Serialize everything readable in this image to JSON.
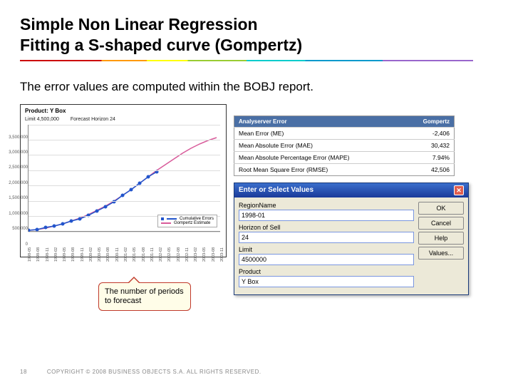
{
  "title": {
    "line1": "Simple Non Linear Regression",
    "line2": "Fitting a S-shaped curve (Gompertz)"
  },
  "body_text": "The error values are computed within the BOBJ report.",
  "chart": {
    "product": "Product: Y Box",
    "limit_label": "Limit",
    "limit_value": "4,500,000",
    "horizon_label": "Forecast Horizon",
    "horizon_value": "24",
    "legend": {
      "series1": "Cumulative Errors",
      "series2": "Gompertz Estimate"
    }
  },
  "chart_data": {
    "type": "line",
    "title": "Product: Y Box",
    "xlabel": "",
    "ylabel": "",
    "ylim": [
      0,
      3500000
    ],
    "yticks": [
      "0",
      "500,000",
      "1,000,000",
      "1,500,000",
      "2,000,000",
      "2,500,000",
      "3,000,000",
      "3,500,000"
    ],
    "categories": [
      "1998-05",
      "1998-08",
      "1998-11",
      "1999-02",
      "1999-05",
      "1999-08",
      "1999-11",
      "2000-02",
      "2000-05",
      "2000-08",
      "2000-11",
      "2001-02",
      "2001-05",
      "2001-08",
      "2001-11",
      "2002-02",
      "2002-05",
      "2002-08",
      "2002-11",
      "2003-02",
      "2003-05",
      "2003-08",
      "2003-11"
    ],
    "series": [
      {
        "name": "Cumulative Errors",
        "values": [
          50000,
          80000,
          130000,
          190000,
          260000,
          340000,
          430000,
          540000,
          670000,
          820000,
          990000,
          1180000,
          1380000,
          1590000,
          1790000,
          1960000
        ]
      },
      {
        "name": "Gompertz Estimate",
        "values": [
          40000,
          70000,
          120000,
          180000,
          260000,
          350000,
          450000,
          570000,
          700000,
          850000,
          1010000,
          1190000,
          1380000,
          1580000,
          1790000,
          2000000,
          2200000,
          2390000,
          2570000,
          2730000,
          2870000,
          2990000,
          3090000
        ]
      }
    ]
  },
  "metrics": {
    "header_method": "Analyserver Error",
    "header_model": "Gompertz",
    "rows": [
      {
        "label": "Mean Error (ME)",
        "value": "-2,406"
      },
      {
        "label": "Mean Absolute Error (MAE)",
        "value": "30,432"
      },
      {
        "label": "Mean Absolute Percentage Error (MAPE)",
        "value": "7.94%"
      },
      {
        "label": "Root Mean Square Error (RMSE)",
        "value": "42,506"
      }
    ]
  },
  "dialog": {
    "title": "Enter or Select Values",
    "fields": {
      "region_label": "RegionName",
      "region_value": "1998-01",
      "horizon_label": "Horizon of Sell",
      "horizon_value": "24",
      "limit_label": "Limit",
      "limit_value": "4500000",
      "product_label": "Product",
      "product_value": "Y Box"
    },
    "buttons": {
      "ok": "OK",
      "cancel": "Cancel",
      "help": "Help",
      "values": "Values..."
    }
  },
  "callout": "The number of periods to forecast",
  "footer": {
    "page": "18",
    "copyright": "COPYRIGHT © 2008 BUSINESS OBJECTS S.A.  ALL RIGHTS RESERVED."
  }
}
